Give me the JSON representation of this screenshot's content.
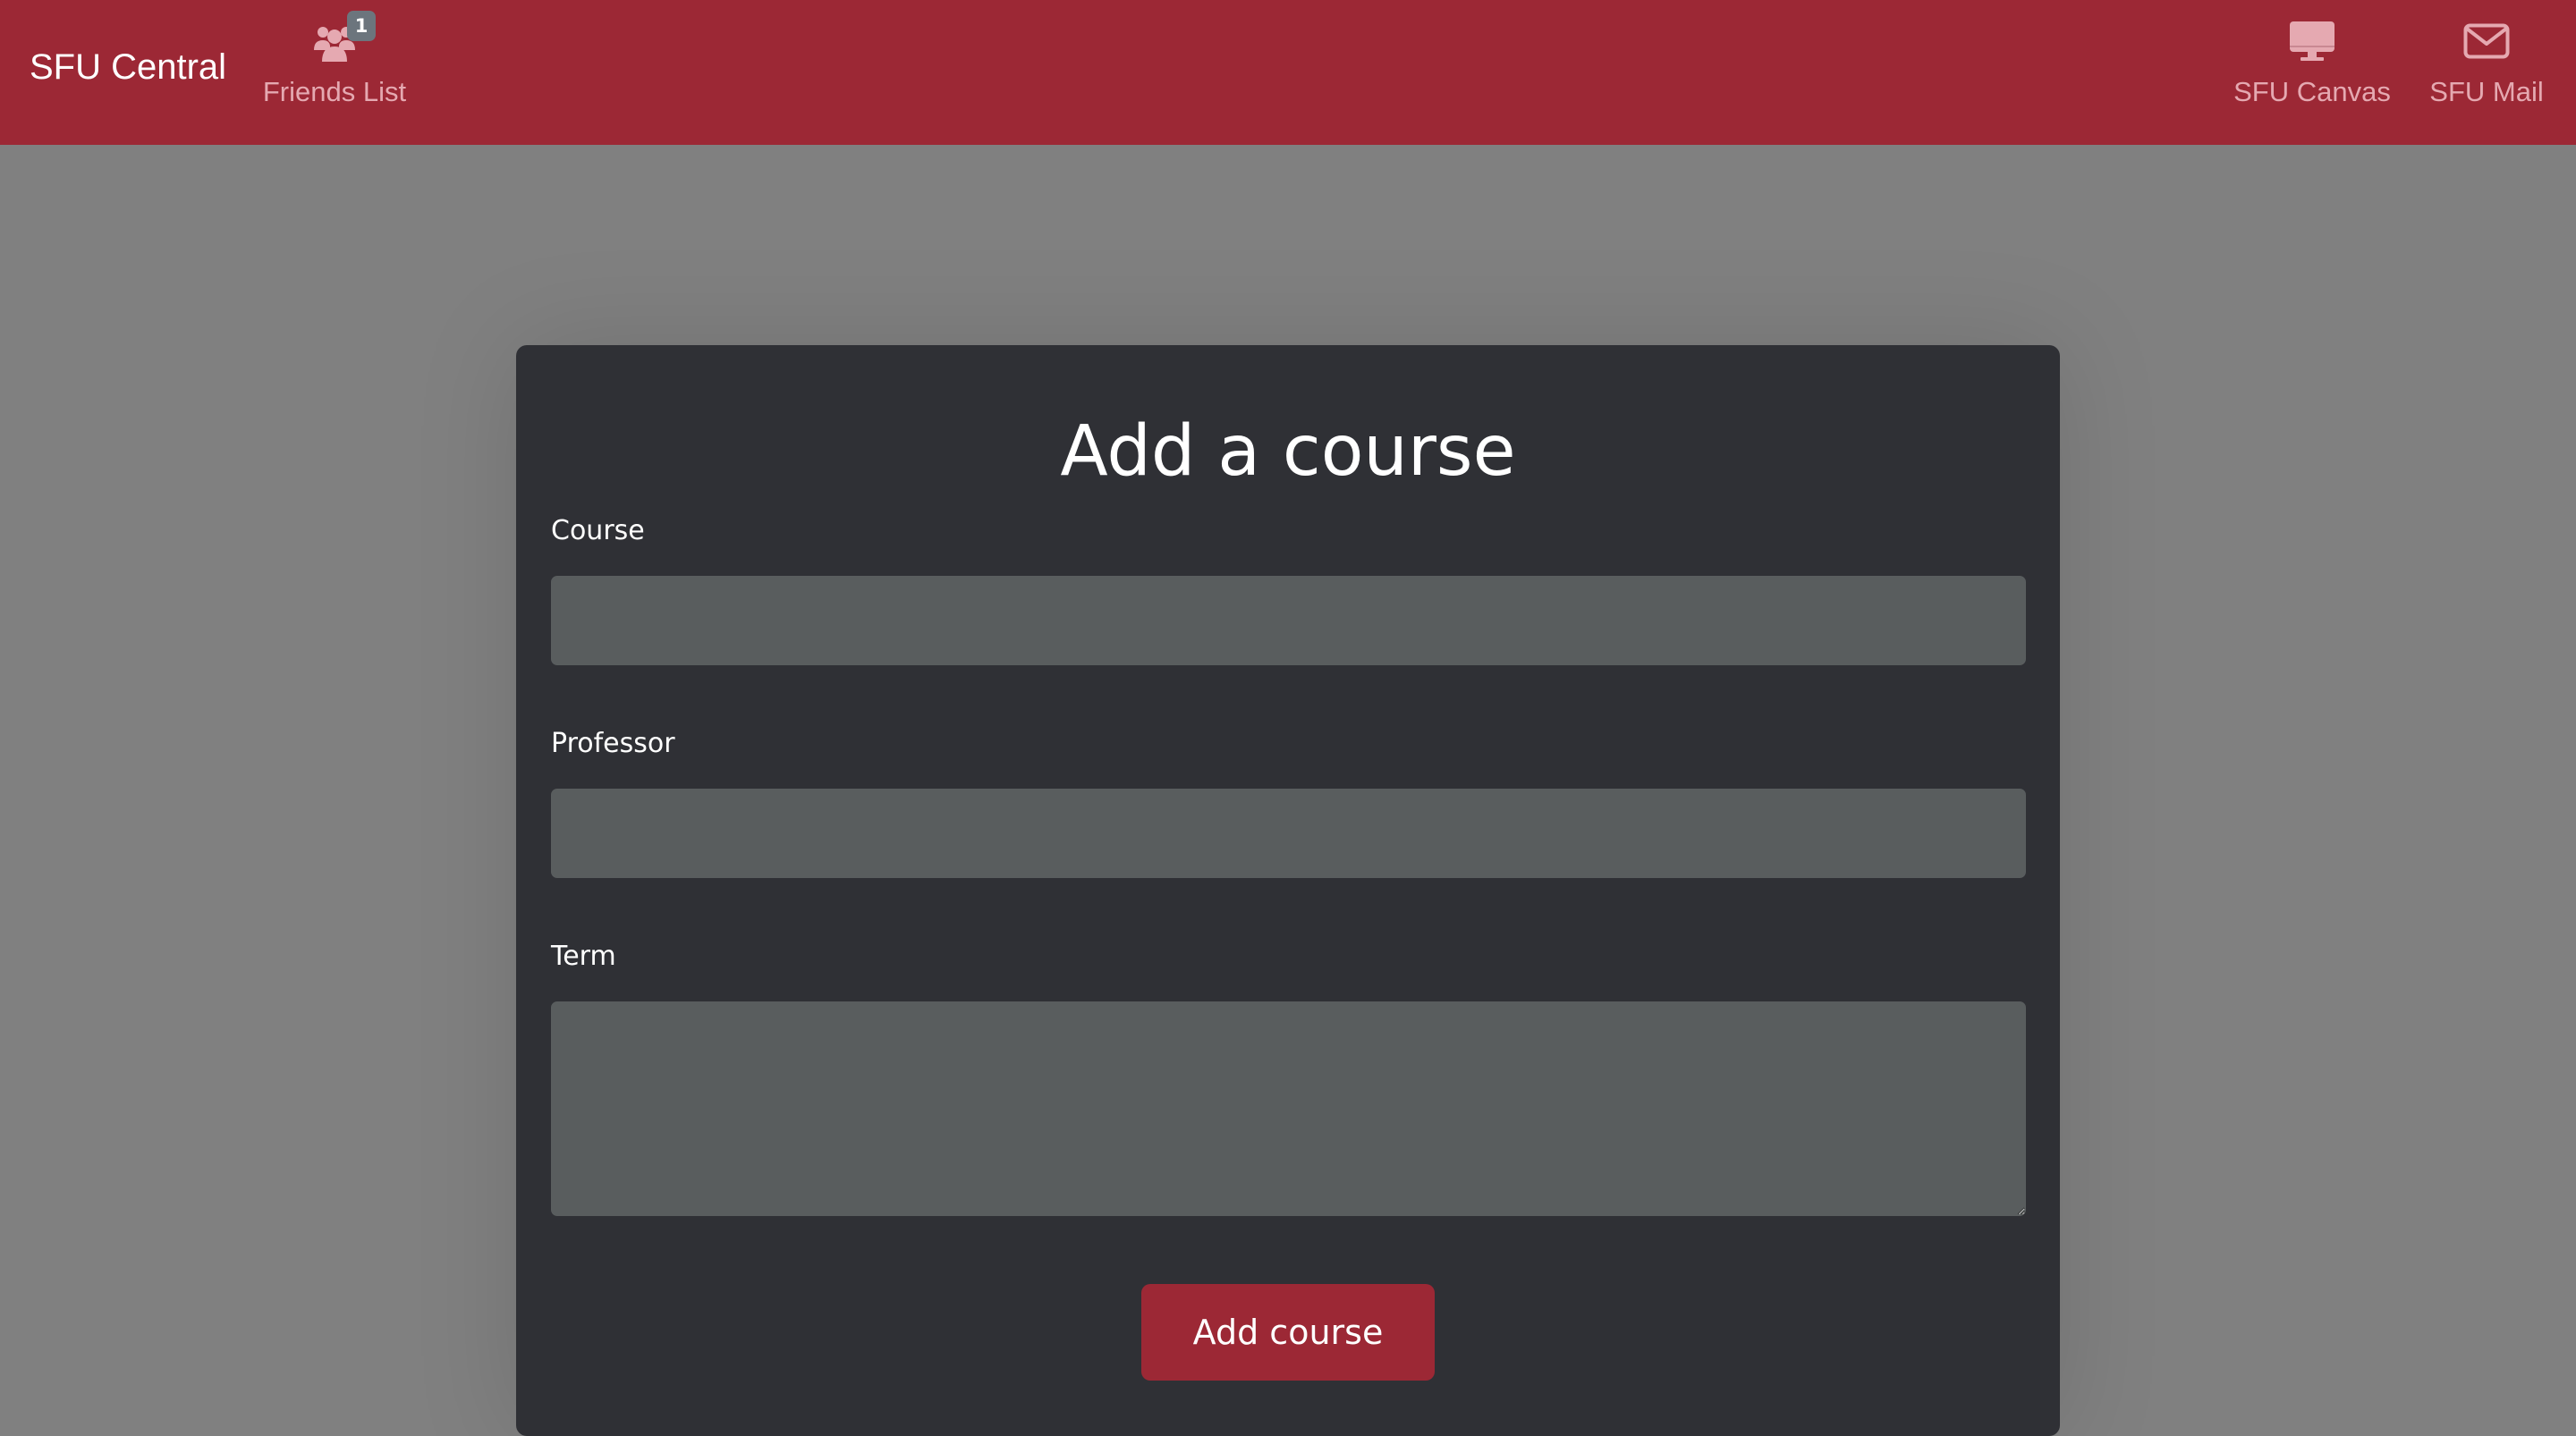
{
  "navbar": {
    "brand": "SFU Central",
    "items": [
      {
        "label": "Friends List",
        "icon": "users-icon",
        "badge": "1"
      },
      {
        "label": "SFU Canvas",
        "icon": "monitor-icon"
      },
      {
        "label": "SFU Mail",
        "icon": "envelope-icon"
      }
    ],
    "colors": {
      "background": "#9c2835",
      "link": "#e5a9b1"
    }
  },
  "form": {
    "title": "Add a course",
    "fields": [
      {
        "label": "Course",
        "value": "",
        "type": "text"
      },
      {
        "label": "Professor",
        "value": "",
        "type": "text"
      },
      {
        "label": "Term",
        "value": "",
        "type": "textarea"
      }
    ],
    "submit_label": "Add course"
  },
  "colors": {
    "page_background": "#808080",
    "card_background": "#2f3035",
    "input_background": "#595d5e",
    "accent": "#9c2835"
  }
}
